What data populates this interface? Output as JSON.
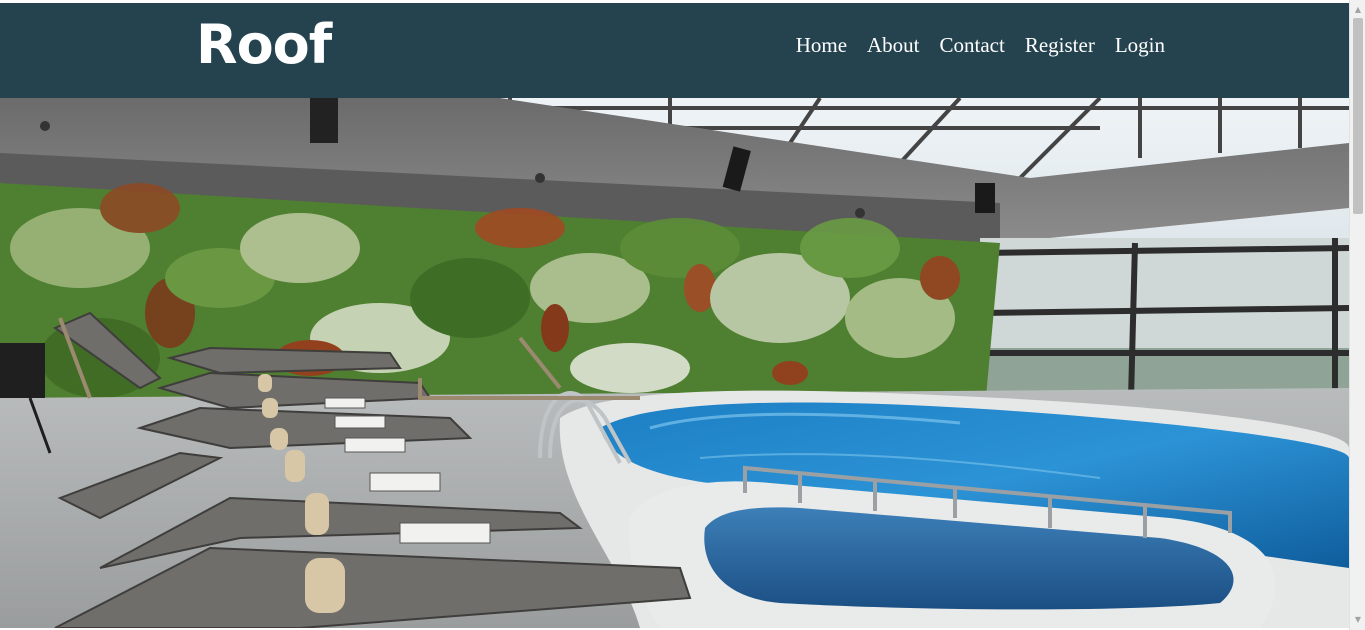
{
  "brand": {
    "name": "Roof"
  },
  "nav": {
    "items": [
      {
        "label": "Home"
      },
      {
        "label": "About"
      },
      {
        "label": "Contact"
      },
      {
        "label": "Register"
      },
      {
        "label": "Login"
      }
    ]
  },
  "hero": {
    "image": "indoor-rooftop-pool-with-living-green-wall-and-sun-loungers"
  },
  "colors": {
    "header": "#24434f",
    "nav_text": "#ffffff",
    "brand_text": "#ffffff"
  },
  "icons": {
    "scroll_up": "scroll-up-arrow-icon",
    "scroll_down": "scroll-down-arrow-icon"
  }
}
